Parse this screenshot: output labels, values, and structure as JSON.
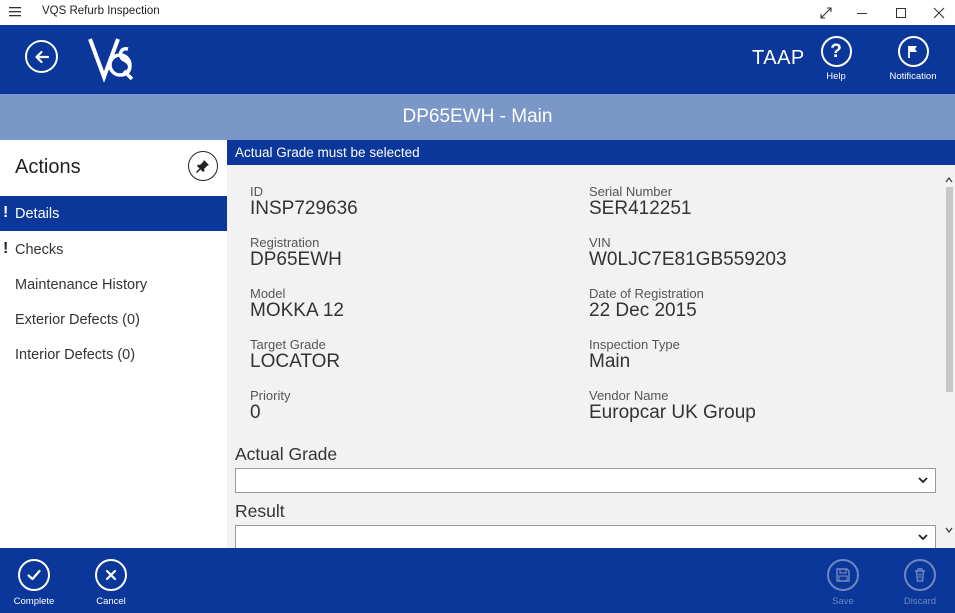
{
  "window": {
    "title": "VQS Refurb Inspection"
  },
  "header": {
    "user": "TAAP",
    "help_label": "Help",
    "notification_label": "Notification"
  },
  "page": {
    "title": "DP65EWH - Main"
  },
  "sidebar": {
    "title": "Actions",
    "items": [
      {
        "label": "Details",
        "warning": "!"
      },
      {
        "label": "Checks",
        "warning": "!"
      },
      {
        "label": "Maintenance History"
      },
      {
        "label": "Exterior Defects (0)"
      },
      {
        "label": "Interior Defects (0)"
      }
    ]
  },
  "main": {
    "error": "Actual Grade must be selected",
    "fields": {
      "id": {
        "label": "ID",
        "value": "INSP729636"
      },
      "serial": {
        "label": "Serial Number",
        "value": "SER412251"
      },
      "registration": {
        "label": "Registration",
        "value": "DP65EWH"
      },
      "vin": {
        "label": "VIN",
        "value": "W0LJC7E81GB559203"
      },
      "model": {
        "label": "Model",
        "value": "MOKKA 12"
      },
      "date_reg": {
        "label": "Date of Registration",
        "value": "22 Dec 2015"
      },
      "target_grade": {
        "label": "Target Grade",
        "value": "LOCATOR"
      },
      "inspection_type": {
        "label": "Inspection Type",
        "value": "Main"
      },
      "priority": {
        "label": "Priority",
        "value": "0"
      },
      "vendor": {
        "label": "Vendor Name",
        "value": "Europcar UK Group"
      }
    },
    "actual_grade": {
      "label": "Actual Grade",
      "value": ""
    },
    "result": {
      "label": "Result",
      "value": ""
    }
  },
  "bottombar": {
    "complete_label": "Complete",
    "cancel_label": "Cancel",
    "save_label": "Save",
    "discard_label": "Discard"
  },
  "colors": {
    "primary": "#0a3799",
    "page_title_bg": "#7a97c8",
    "content_bg": "#f2f2f2",
    "disabled": "#6f87c0"
  },
  "icons": [
    "hamburger-icon",
    "maximize-icon",
    "minimize-icon",
    "restore-icon",
    "close-icon",
    "back-arrow-icon",
    "vqs-logo",
    "help-icon",
    "flag-icon",
    "pin-icon",
    "chevron-down-icon",
    "check-icon",
    "x-icon",
    "save-icon",
    "trash-icon"
  ]
}
